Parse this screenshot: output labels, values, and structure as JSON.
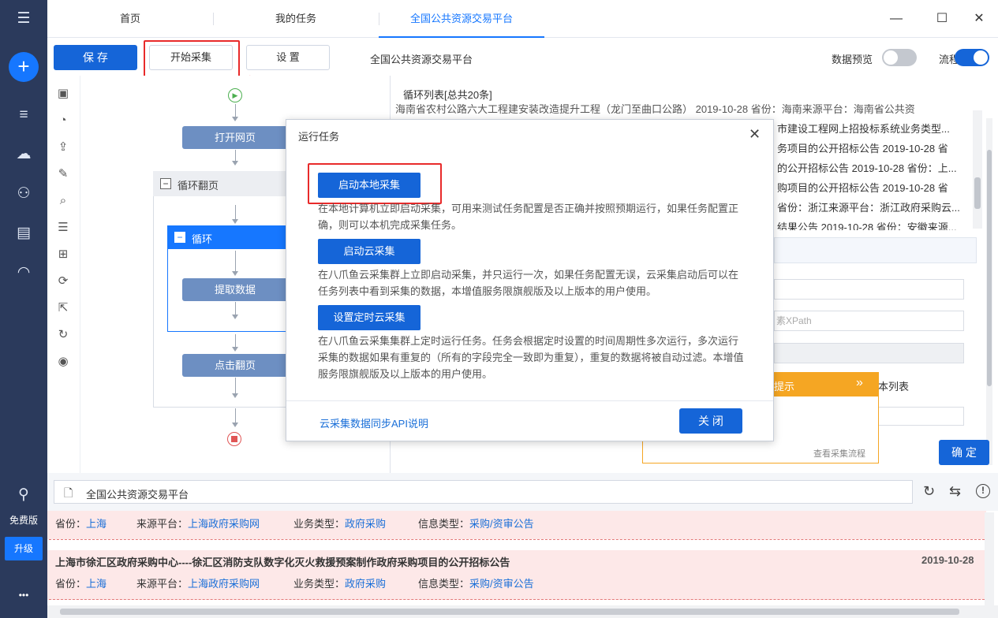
{
  "sidebar": {
    "free_label": "免费版",
    "upgrade_label": "升级",
    "more_label": "•••"
  },
  "tabs": [
    {
      "label": "首页"
    },
    {
      "label": "我的任务"
    },
    {
      "label": "全国公共资源交易平台"
    }
  ],
  "toolbar": {
    "save_label": "保 存",
    "start_label": "开始采集",
    "settings_label": "设 置",
    "task_title": "全国公共资源交易平台",
    "preview_label": "数据预览",
    "flow_label": "流程"
  },
  "flow": {
    "open_page": "打开网页",
    "loop_page": "循环翻页",
    "loop": "循环",
    "extract": "提取数据",
    "click_page": "点击翻页"
  },
  "right": {
    "list_header": "循环列表[总共20条]",
    "rows": [
      "海南省农村公路六大工程建安装改造提升工程（龙门至曲口公路） 2019-10-28 省份：海南来源平台：海南省公共资",
      "市建设工程网上招投标系统业务类型...",
      "务项目的公开招标公告 2019-10-28 省",
      "的公开招标公告 2019-10-28 省份：上...",
      "购项目的公开招标公告 2019-10-28 省",
      "省份：浙江来源平台：浙江政府采购云...",
      "结果公告 2019-10-28 省份：安徽来源..."
    ],
    "xpath_placeholder": "素XPath",
    "tip_label": "提示",
    "tip_arrow": "»",
    "view_flow": "查看采集流程",
    "text_list": "本列表",
    "confirm_label": "确 定"
  },
  "dialog": {
    "title": "运行任务",
    "local_btn": "启动本地采集",
    "local_desc": "在本地计算机立即启动采集，可用来测试任务配置是否正确并按照预期运行，如果任务配置正确，则可以本机完成采集任务。",
    "cloud_btn": "启动云采集",
    "cloud_desc": "在八爪鱼云采集群上立即启动采集，并只运行一次，如果任务配置无误，云采集启动后可以在任务列表中看到采集的数据，本增值服务限旗舰版及以上版本的用户使用。",
    "timer_btn": "设置定时云采集",
    "timer_desc": "在八爪鱼云采集集群上定时运行任务。任务会根据定时设置的时间周期性多次运行，多次运行采集的数据如果有重复的（所有的字段完全一致即为重复），重复的数据将被自动过滤。本增值服务限旗舰版及以上版本的用户使用。",
    "api_link": "云采集数据同步API说明",
    "close_label": "关 闭"
  },
  "bottom": {
    "url_text": "全国公共资源交易平台",
    "result1": {
      "province_k": "省份：",
      "province_v": "上海",
      "source_k": "来源平台：",
      "source_v": "上海政府采购网",
      "biz_k": "业务类型：",
      "biz_v": "政府采购",
      "info_k": "信息类型：",
      "info_v": "采购/资审公告"
    },
    "result2": {
      "title": "上海市徐汇区政府采购中心----徐汇区消防支队数字化灭火救援预案制作政府采购项目的公开招标公告",
      "date": "2019-10-28",
      "province_k": "省份：",
      "province_v": "上海",
      "source_k": "来源平台：",
      "source_v": "上海政府采购网",
      "biz_k": "业务类型：",
      "biz_v": "政府采购",
      "info_k": "信息类型：",
      "info_v": "采购/资审公告"
    }
  },
  "colors": {
    "primary": "#1565d8",
    "sidebar": "#2b3a5c",
    "highlight": "#e82a2a",
    "node": "#6d8fc2",
    "tip": "#f5a623"
  }
}
